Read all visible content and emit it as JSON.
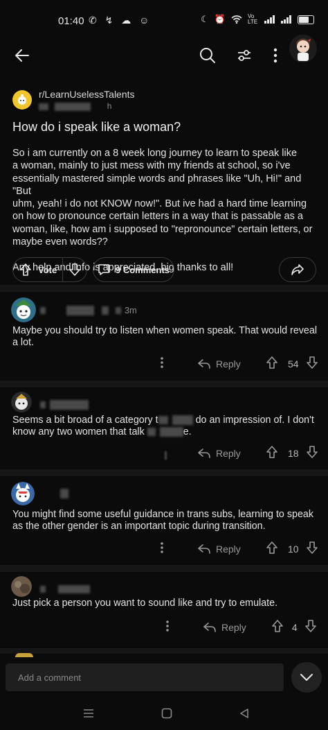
{
  "status_bar": {
    "time": "01:40",
    "network_label": "Vo LTE"
  },
  "post": {
    "subreddit": "r/LearnUselessTalents",
    "age_suffix": "h",
    "title": "How do i speak like a woman?",
    "body": "So i am currently on a 8 week long journey to learn to speak like\na woman, mainly to just mess with my friends at school, so i've\nessentially mastered simple words and phrases like \"Uh, Hi!\" and \"But\nuhm, yeah! i do not KNOW now!\". But ive had a hard time learning\non how to pronounce certain letters in a way that is passable as a\nwoman, like, how am i supposed to \"repronounce\" certain letters, or\nmaybe even words??\n\nAny help and info is appreciated, big thanks to all!",
    "vote_label": "Vote",
    "comments_label": "9 Comments"
  },
  "comments": [
    {
      "age": "3m",
      "text": "Maybe you should try to listen when women speak. That would reveal a lot.",
      "reply_label": "Reply",
      "score": "54"
    },
    {
      "age": "",
      "text_part1": "Seems a bit broad of a category t",
      "text_part2": "do an impression of. I don't",
      "text_line2_part1": "know any two women that talk",
      "text_line2_part2": "e.",
      "reply_label": "Reply",
      "score": "18"
    },
    {
      "age": "",
      "text": "You might find some useful guidance in trans subs, learning to speak as the other gender is an important topic during transition.",
      "reply_label": "Reply",
      "score": "10"
    },
    {
      "age": "",
      "text": "Just pick a person you want to sound like and try to emulate.",
      "reply_label": "Reply",
      "score": "4"
    }
  ],
  "bottom": {
    "add_comment_placeholder": "Add a comment"
  },
  "colors": {
    "background": "#0b0b0b",
    "separator": "#161616",
    "subreddit_icon": "#f0c62c"
  }
}
